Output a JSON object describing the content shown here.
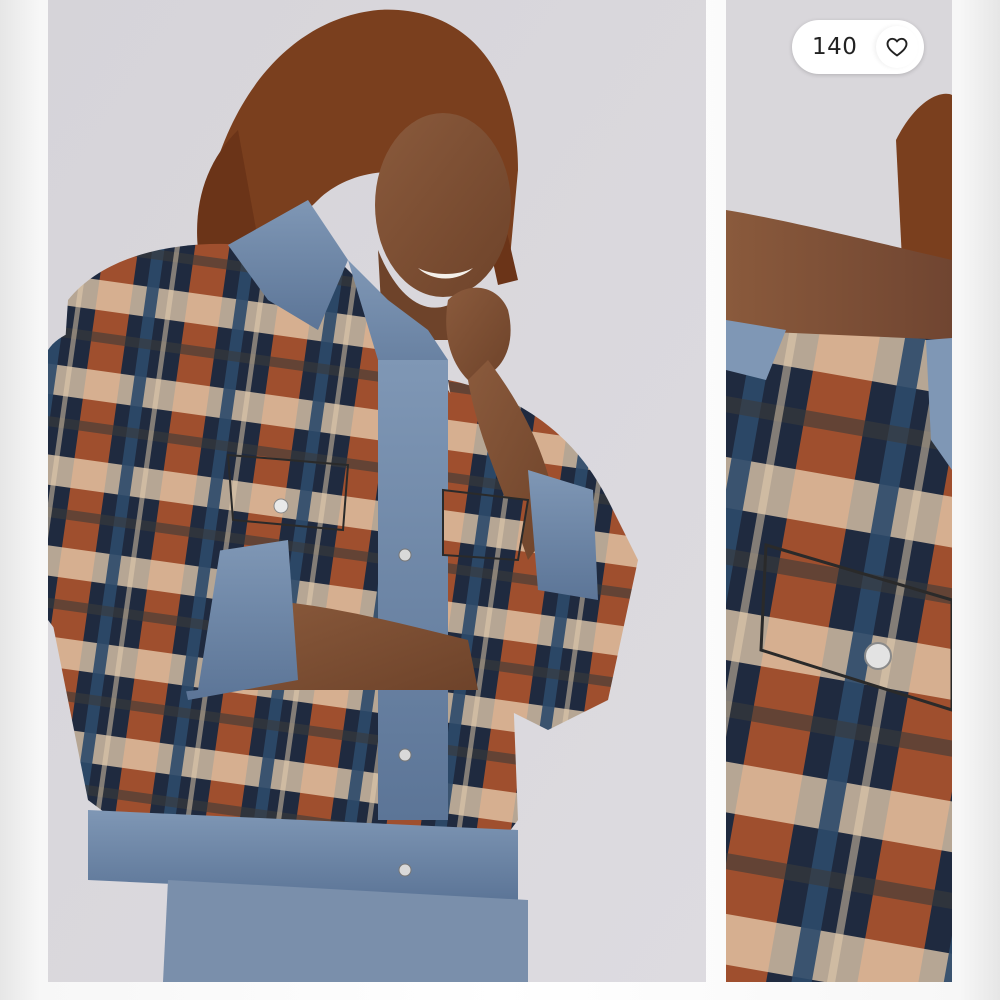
{
  "listing": {
    "like_count": "140",
    "like_icon": "heart-outline-icon"
  },
  "photos": [
    {
      "subject": "main-product-photo"
    },
    {
      "subject": "detail-product-photo"
    }
  ],
  "colors": {
    "background_studio": "#d9d7db",
    "plaid_navy": "#1f2a3f",
    "plaid_rust": "#b5562b",
    "plaid_cream": "#e8cfb0",
    "denim": "#6d87a8"
  }
}
